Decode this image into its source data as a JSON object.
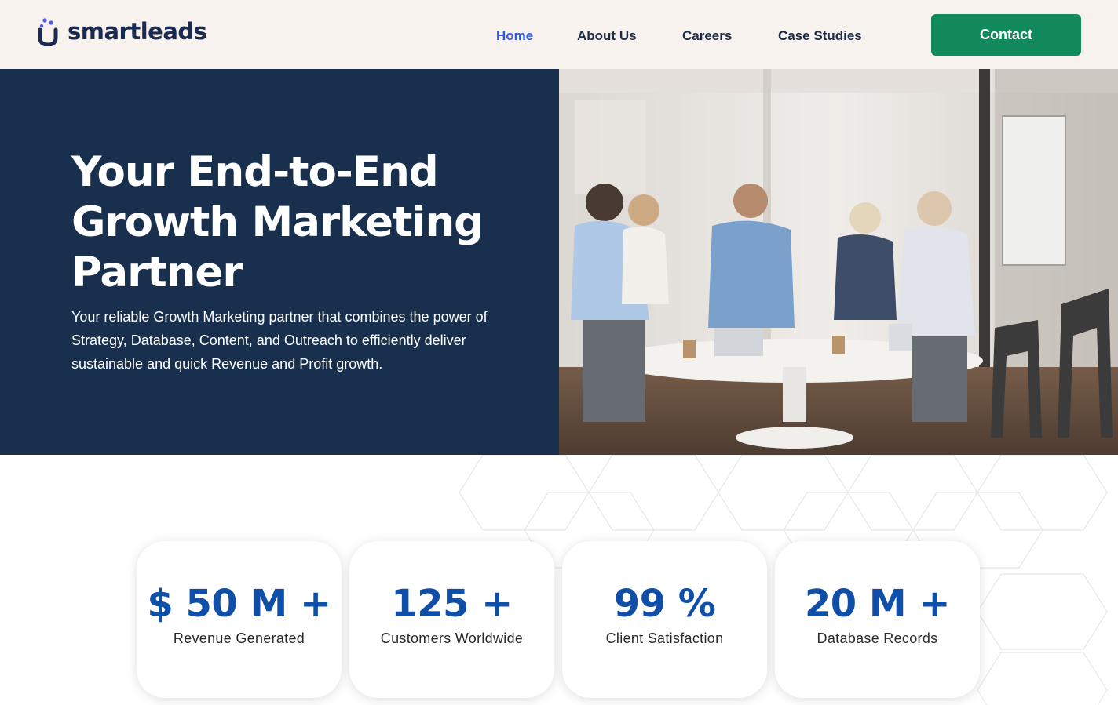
{
  "header": {
    "logo_text": "smartleads",
    "nav": [
      {
        "label": "Home",
        "active": true
      },
      {
        "label": "About Us",
        "active": false
      },
      {
        "label": "Careers",
        "active": false
      },
      {
        "label": "Case Studies",
        "active": false
      }
    ],
    "contact_label": "Contact"
  },
  "hero": {
    "title": "Your End-to-End Growth Marketing Partner",
    "subtitle": "Your reliable Growth Marketing partner that combines the power of Strategy, Database, Content, and Outreach to efficiently deliver sustainable and quick Revenue and Profit growth.",
    "image_icon": "office-meeting-photo"
  },
  "stats": [
    {
      "value": "$ 50 M +",
      "label": "Revenue Generated"
    },
    {
      "value": "125 +",
      "label": "Customers Worldwide"
    },
    {
      "value": "99 %",
      "label": "Client Satisfaction"
    },
    {
      "value": "20 M +",
      "label": "Database Records"
    }
  ],
  "colors": {
    "header_bg": "#f7f2ee",
    "hero_bg": "#18304d",
    "accent_nav": "#2d57e8",
    "contact_bg": "#128a5c",
    "stat_value": "#0f4fa8"
  }
}
